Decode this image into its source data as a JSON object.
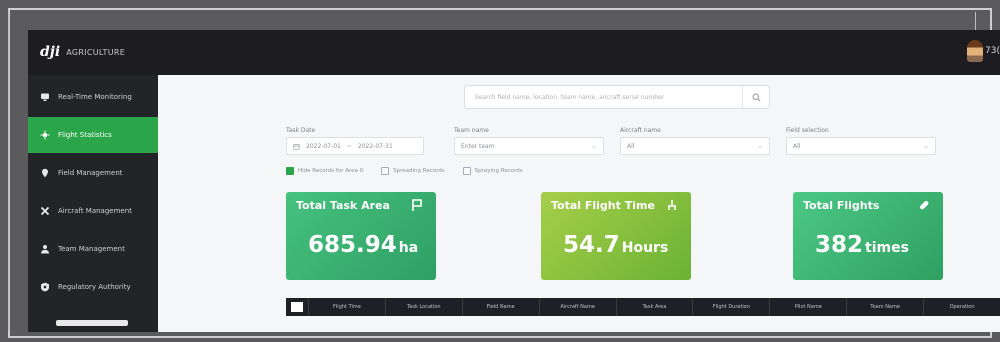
{
  "app": {
    "logo_mark": "dji",
    "logo_text": "AGRICULTURE",
    "user_label": "73("
  },
  "sidebar": {
    "items": [
      {
        "label": "Real-Time Monitoring",
        "icon": "monitor-icon",
        "active": false
      },
      {
        "label": "Flight Statistics",
        "icon": "statistics-icon",
        "active": true
      },
      {
        "label": "Field Management",
        "icon": "location-pin-icon",
        "active": false
      },
      {
        "label": "Aircraft Management",
        "icon": "aircraft-icon",
        "active": false
      },
      {
        "label": "Team Management",
        "icon": "team-icon",
        "active": false
      },
      {
        "label": "Regulatory Authority",
        "icon": "shield-icon",
        "active": false
      }
    ]
  },
  "search": {
    "placeholder": "Search field name, location, team name, aircraft serial number"
  },
  "filters": {
    "task_date": {
      "label": "Task Date",
      "start": "2022-07-01",
      "end": "2022-07-31"
    },
    "team_name": {
      "label": "Team name",
      "value": "Enter team"
    },
    "aircraft_name": {
      "label": "Aircraft name",
      "value": "All"
    },
    "field_selection": {
      "label": "Field selection",
      "value": "All"
    }
  },
  "options": [
    {
      "label": "Hide Records for Area 0",
      "checked": true
    },
    {
      "label": "Spreading Records",
      "checked": false
    },
    {
      "label": "Spraying Records",
      "checked": false
    }
  ],
  "cards": [
    {
      "title": "Total Task Area",
      "value": "685.94",
      "unit": "ha",
      "icon": "flag-icon"
    },
    {
      "title": "Total Flight Time",
      "value": "54.7",
      "unit": "Hours",
      "icon": "drone-icon"
    },
    {
      "title": "Total Flights",
      "value": "382",
      "unit": "times",
      "icon": "pill-icon"
    }
  ],
  "table": {
    "columns": [
      "Flight Time",
      "Task Location",
      "Field Name",
      "Aircraft Name",
      "Task Area",
      "Flight Duration",
      "Pilot Name",
      "Team Name",
      "Operation"
    ]
  },
  "colors": {
    "accent": "#2aa54a",
    "topbar": "#1d1d21",
    "sidebar": "#232427"
  }
}
